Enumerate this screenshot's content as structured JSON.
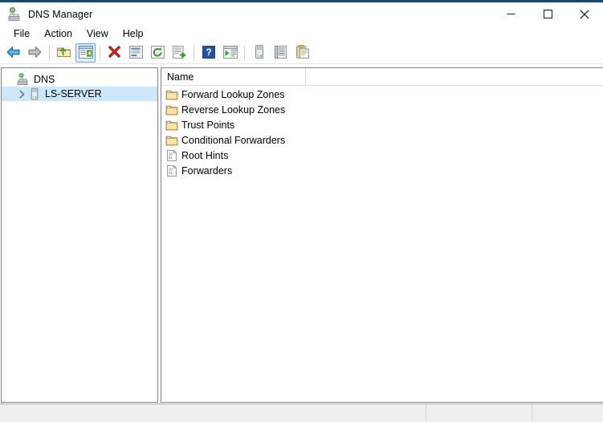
{
  "window": {
    "title": "DNS Manager",
    "title_icon": "dns-server-icon",
    "accent_color": "#1b4a6b",
    "caption": {
      "minimize": "minimize-button",
      "maximize": "maximize-button",
      "close": "close-button"
    }
  },
  "menubar": {
    "items": [
      {
        "label": "File"
      },
      {
        "label": "Action"
      },
      {
        "label": "View"
      },
      {
        "label": "Help"
      }
    ]
  },
  "toolbar": {
    "buttons": [
      {
        "name": "back-button",
        "icon": "back-arrow-icon",
        "checked": false
      },
      {
        "name": "forward-button",
        "icon": "forward-arrow-icon",
        "checked": false
      },
      {
        "name": "up-one-level-button",
        "icon": "folder-up-icon",
        "checked": false
      },
      {
        "name": "show-hide-console-tree-button",
        "icon": "console-tree-icon",
        "checked": true
      },
      {
        "name": "delete-button",
        "icon": "delete-x-icon",
        "checked": false
      },
      {
        "name": "properties-button",
        "icon": "properties-icon",
        "checked": false
      },
      {
        "name": "refresh-button",
        "icon": "refresh-icon",
        "checked": false
      },
      {
        "name": "export-list-button",
        "icon": "export-list-icon",
        "checked": false
      },
      {
        "name": "help-button",
        "icon": "help-question-icon",
        "checked": false
      },
      {
        "name": "show-action-pane-button",
        "icon": "action-pane-icon",
        "checked": false
      },
      {
        "name": "new-server-button",
        "icon": "server-tower-icon",
        "checked": false
      },
      {
        "name": "list-view-button",
        "icon": "list-lines-icon",
        "checked": false
      },
      {
        "name": "clipboard-button",
        "icon": "clipboard-icon",
        "checked": false
      }
    ]
  },
  "tree": {
    "nodes": [
      {
        "label": "DNS",
        "icon": "dns-root-icon",
        "level": 0,
        "expander": "none",
        "selected": false
      },
      {
        "label": "LS-SERVER",
        "icon": "server-tower-icon",
        "level": 1,
        "expander": "collapsed",
        "selected": true
      }
    ]
  },
  "listview": {
    "columns": [
      {
        "label": "Name",
        "width": 180
      }
    ],
    "rows": [
      {
        "name": "Forward Lookup Zones",
        "icon": "folder-icon"
      },
      {
        "name": "Reverse Lookup Zones",
        "icon": "folder-icon"
      },
      {
        "name": "Trust Points",
        "icon": "folder-icon"
      },
      {
        "name": "Conditional Forwarders",
        "icon": "folder-icon"
      },
      {
        "name": "Root Hints",
        "icon": "binary-record-icon"
      },
      {
        "name": "Forwarders",
        "icon": "binary-record-icon"
      }
    ]
  },
  "statusbar": {
    "cells": [
      {
        "text": ""
      },
      {
        "text": ""
      },
      {
        "text": ""
      }
    ]
  }
}
